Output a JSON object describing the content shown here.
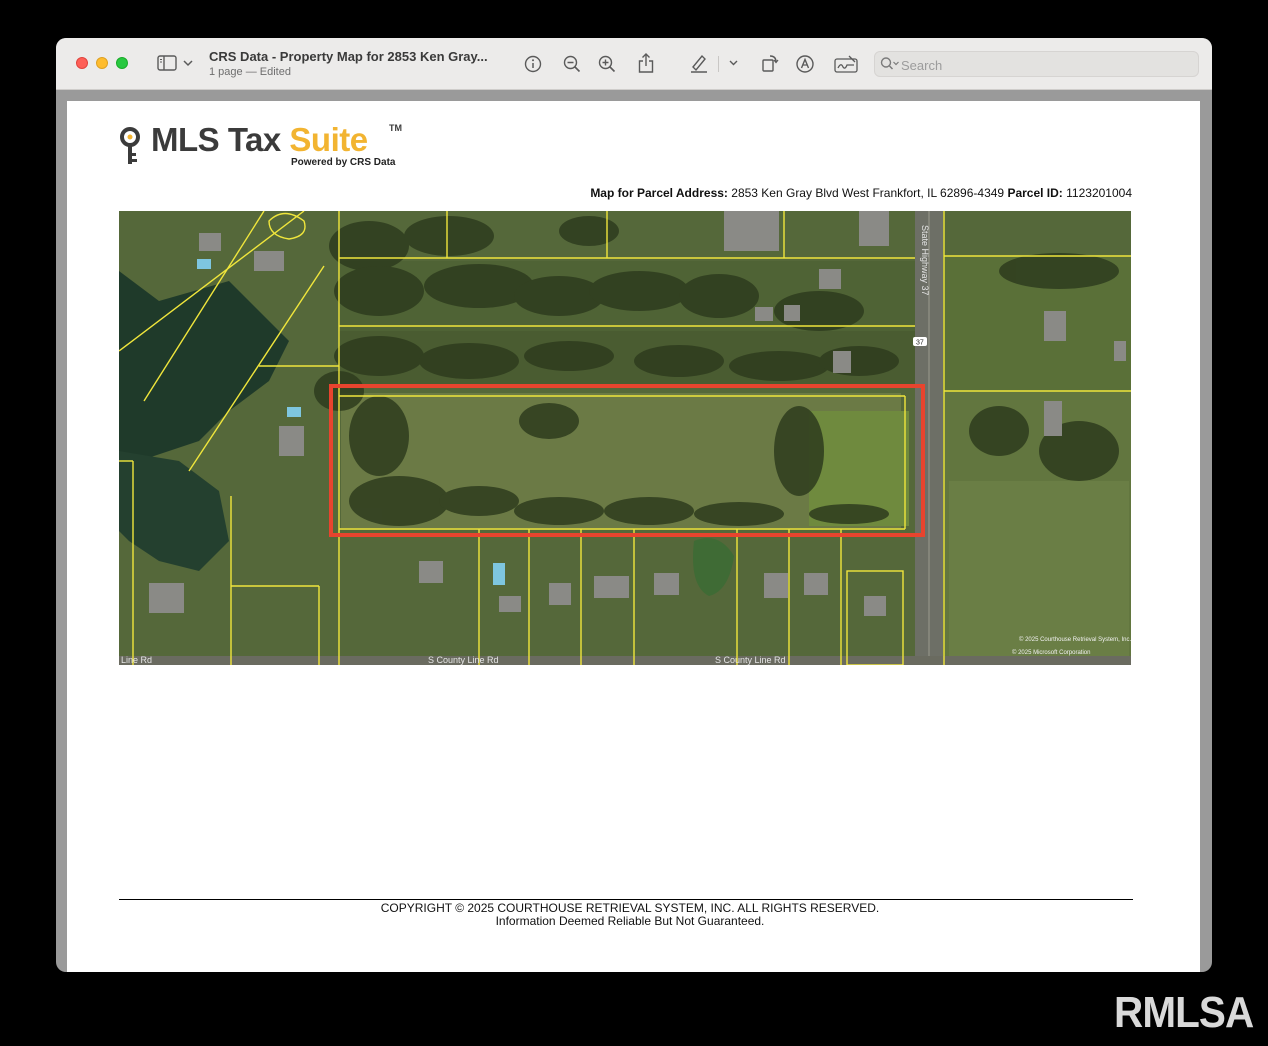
{
  "window": {
    "title": "CRS Data - Property Map for 2853 Ken Gray...",
    "subtitle": "1 page — Edited"
  },
  "toolbar": {
    "icons": [
      "sidebar-icon",
      "chevron-down-icon",
      "info-icon",
      "zoom-out-icon",
      "zoom-in-icon",
      "share-icon",
      "highlight-pen-icon",
      "chevron-down-icon",
      "rotate-icon",
      "markup-icon",
      "signature-icon"
    ]
  },
  "search": {
    "placeholder": "Search",
    "value": ""
  },
  "logo": {
    "mls": "MLS Tax ",
    "suite": "Suite",
    "tm": "TM",
    "powered_by": "Powered by CRS Data"
  },
  "parcel": {
    "address_label": "Map for Parcel Address:",
    "address": "2853 Ken Gray Blvd West Frankfort, IL 62896-4349",
    "id_label": "Parcel ID:",
    "id": "1123201004"
  },
  "map": {
    "road_labels": [
      "State Highway 37",
      "S County Line Rd",
      "S County Line Rd",
      "Line Rd",
      "37"
    ],
    "credits": [
      "© 2025 Courthouse Retrieval System, Inc.",
      "© 2025 Microsoft Corporation"
    ],
    "colors": {
      "parcel_lines": "#f0e63c",
      "highlight": "#e8442e"
    }
  },
  "footer": {
    "copyright": "COPYRIGHT © 2025 COURTHOUSE RETRIEVAL SYSTEM, INC. ALL RIGHTS RESERVED.",
    "disclaimer": "Information Deemed Reliable But Not Guaranteed."
  },
  "watermark": "RMLSA"
}
